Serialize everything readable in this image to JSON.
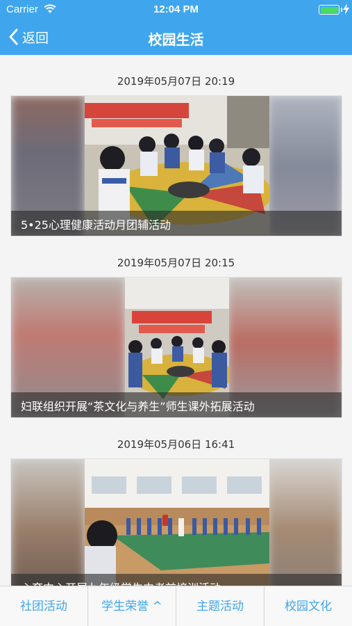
{
  "status_bar": {
    "carrier": "Carrier",
    "time": "12:04 PM",
    "battery_level": 1.0
  },
  "nav": {
    "back_label": "返回",
    "title": "校园生活"
  },
  "news": [
    {
      "time": "2019年05月07日 20:19",
      "caption": "5•25心理健康活动月团辅活动"
    },
    {
      "time": "2019年05月07日 20:15",
      "caption": "妇联组织开展“茶文化与养生”师生课外拓展活动"
    },
    {
      "time": "2019年05月06日 16:41",
      "caption": "心育中心开展九年级学生中考前培训活动"
    }
  ],
  "tabs": [
    {
      "label": "社团活动"
    },
    {
      "label": "学生荣誉 ^"
    },
    {
      "label": "主题活动"
    },
    {
      "label": "校园文化"
    }
  ],
  "colors": {
    "accent": "#3fa6ee",
    "battery": "#4cd964"
  }
}
